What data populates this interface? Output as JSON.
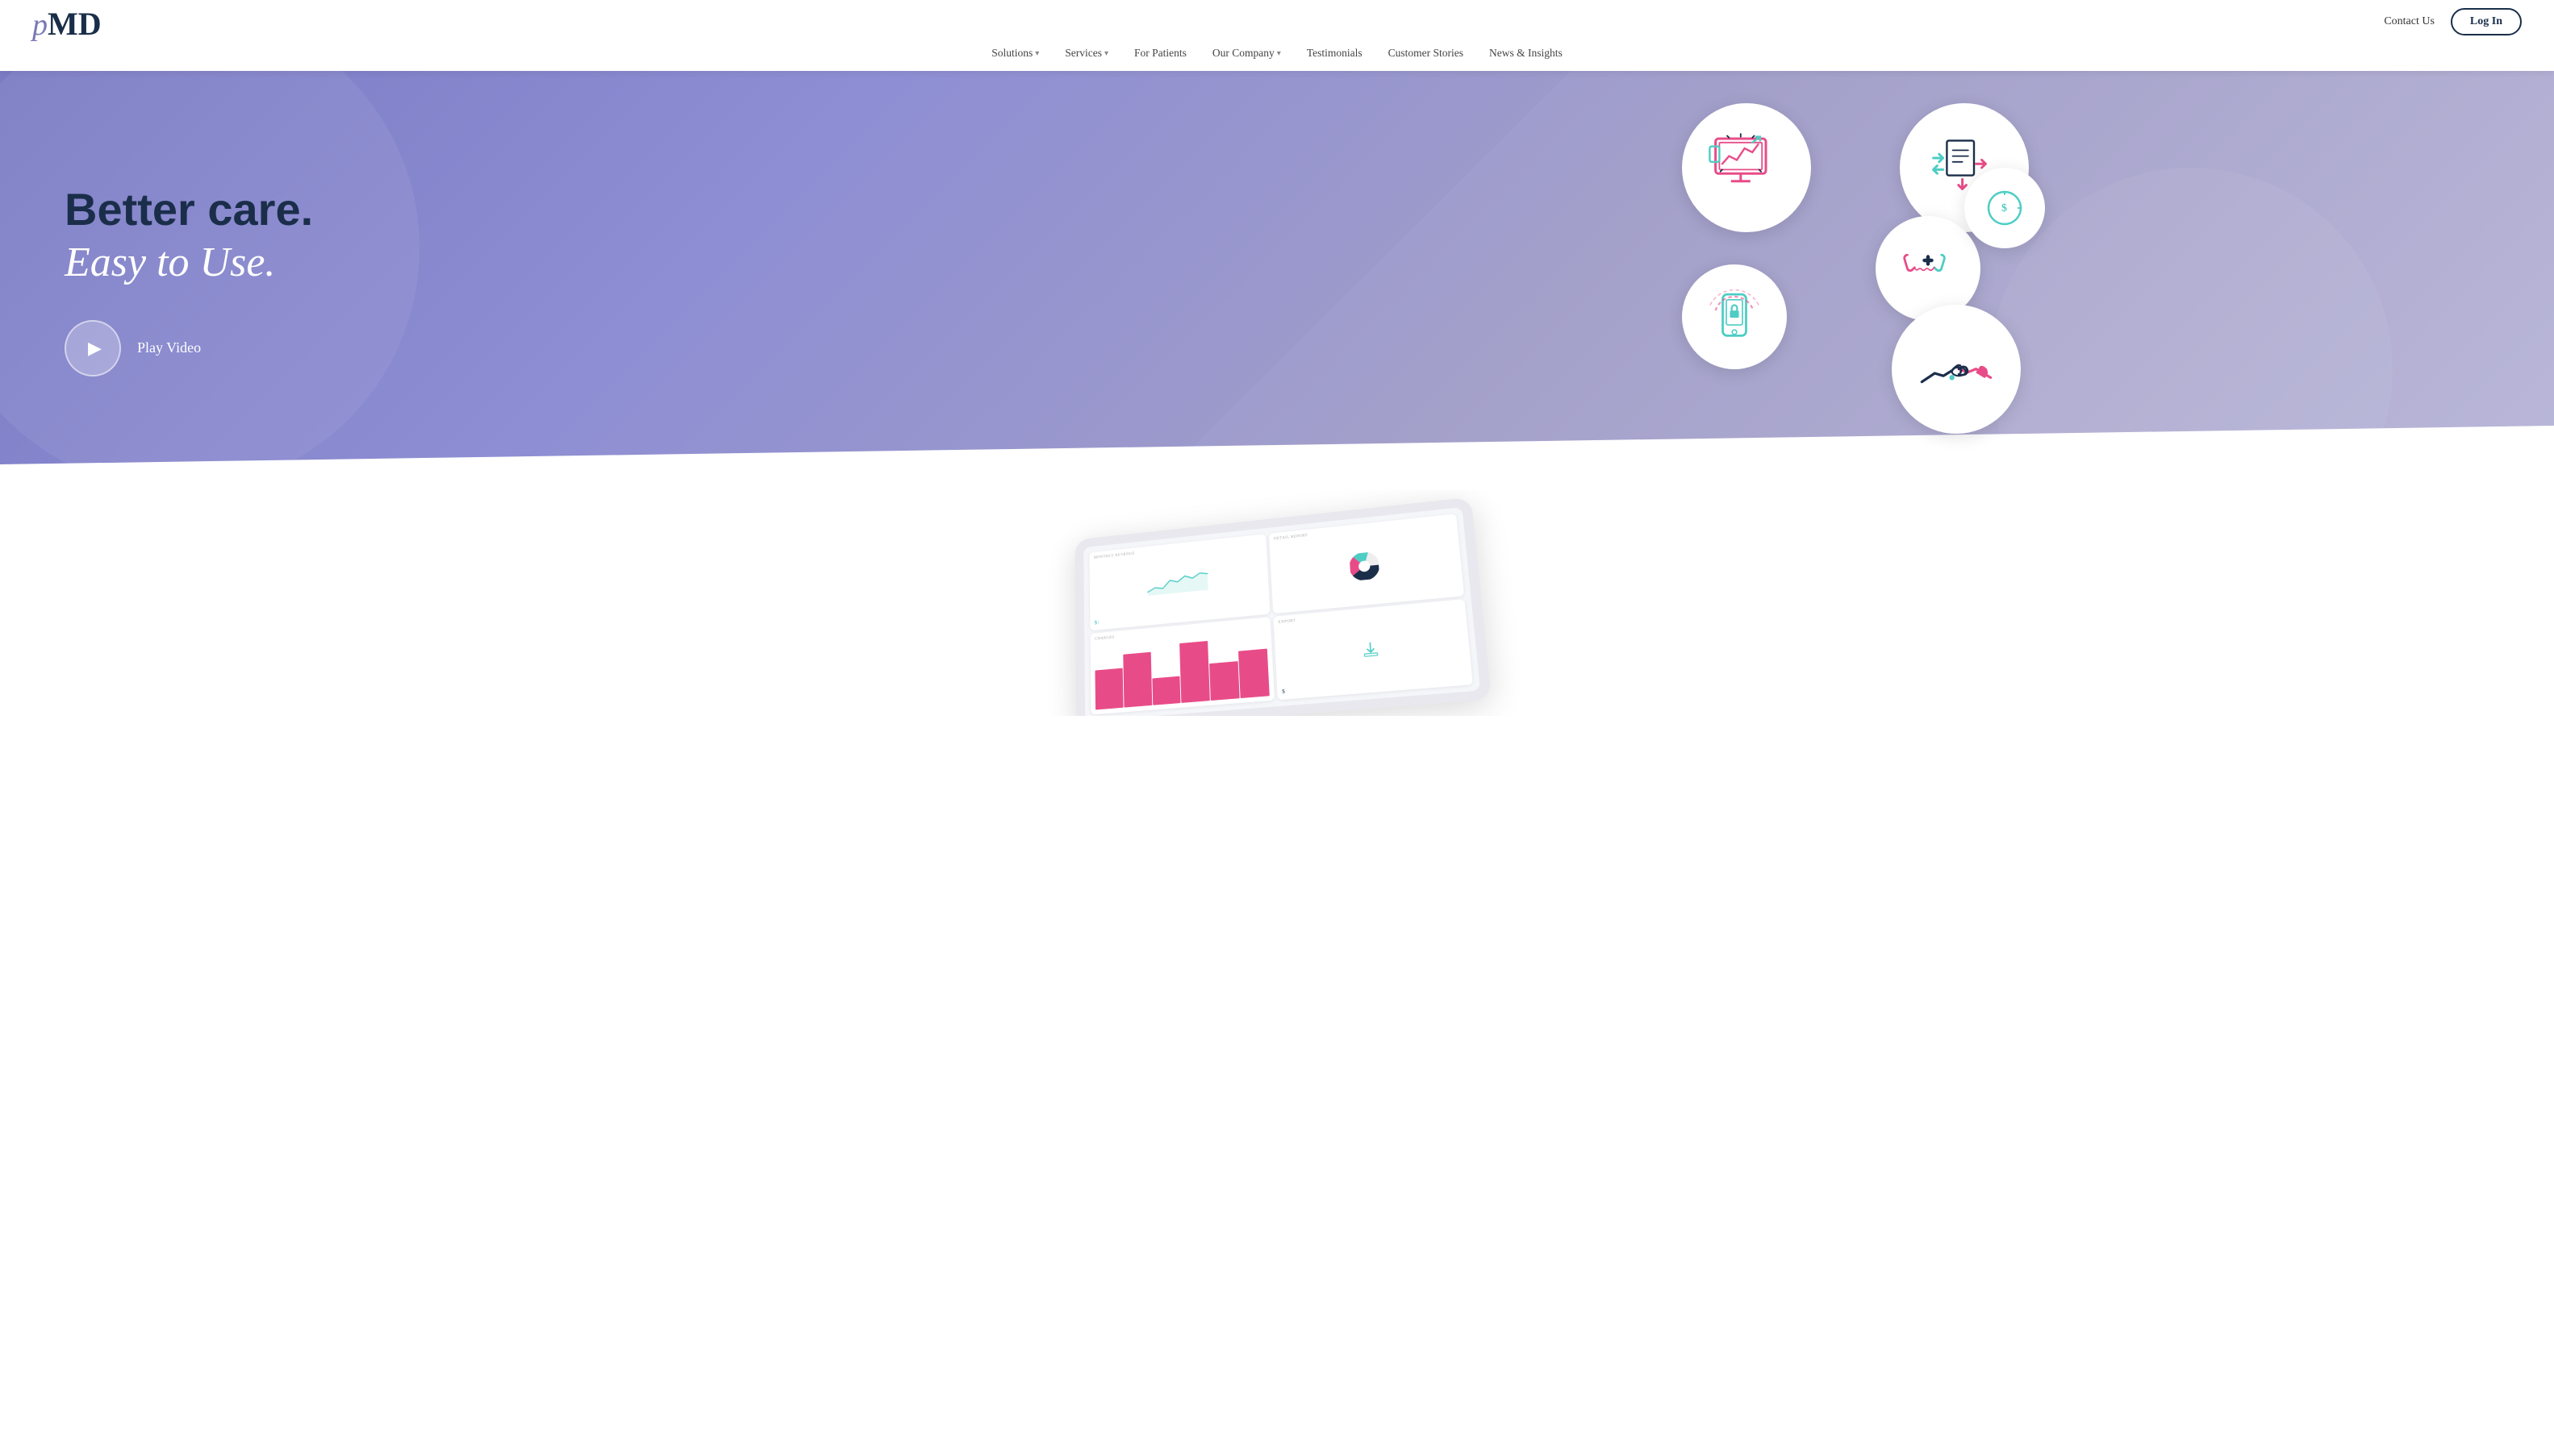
{
  "header": {
    "logo": {
      "p": "p",
      "md": "MD"
    },
    "top_nav": {
      "contact_label": "Contact Us",
      "login_label": "Log In"
    },
    "main_nav": [
      {
        "label": "Solutions",
        "has_dropdown": true
      },
      {
        "label": "Services",
        "has_dropdown": true
      },
      {
        "label": "For Patients",
        "has_dropdown": false
      },
      {
        "label": "Our Company",
        "has_dropdown": true
      },
      {
        "label": "Testimonials",
        "has_dropdown": false
      },
      {
        "label": "Customer Stories",
        "has_dropdown": false
      },
      {
        "label": "News & Insights",
        "has_dropdown": false
      }
    ]
  },
  "hero": {
    "title_bold": "Better care.",
    "title_italic": "Easy to Use.",
    "play_label": "Play Video"
  },
  "icons": {
    "analytics": "analytics-icon",
    "transfer": "data-transfer-icon",
    "phone": "phone-icon",
    "dollar": "dollar-cycle-icon",
    "mobile": "mobile-security-icon",
    "handshake": "handshake-icon"
  },
  "tablet": {
    "cards": [
      {
        "label": "Monthly Revenue",
        "type": "line"
      },
      {
        "label": "Detail Report",
        "type": "pie"
      },
      {
        "label": "Charges",
        "type": "bar"
      },
      {
        "label": "Export",
        "type": "text"
      }
    ]
  },
  "colors": {
    "hero_bg": "#8585c8",
    "accent_teal": "#4ecdc4",
    "accent_pink": "#e84c88",
    "accent_navy": "#1a2e4a",
    "white": "#ffffff"
  }
}
